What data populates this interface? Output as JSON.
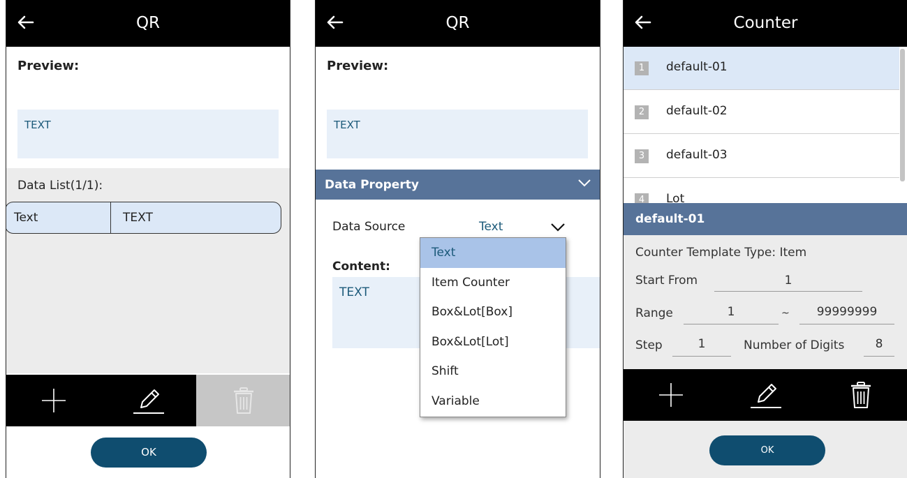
{
  "screen1": {
    "title": "QR",
    "preview_label": "Preview:",
    "preview_text": "TEXT",
    "data_list_title": "Data List(1/1):",
    "row": {
      "type": "Text",
      "value": "TEXT"
    },
    "toolbar": [
      "plus-icon",
      "pencil-icon",
      "trash-icon"
    ],
    "ok_label": "OK"
  },
  "screen2": {
    "title": "QR",
    "preview_label": "Preview:",
    "preview_text": "TEXT",
    "section_title": "Data Property",
    "data_source_label": "Data Source",
    "data_source_value": "Text",
    "content_label": "Content:",
    "content_text": "TEXT",
    "dropdown_options": [
      "Text",
      "Item Counter",
      "Box&Lot[Box]",
      "Box&Lot[Lot]",
      "Shift",
      "Variable"
    ],
    "dropdown_selected": "Text"
  },
  "screen3": {
    "title": "Counter",
    "counters": [
      {
        "num": "1",
        "name": "default-01"
      },
      {
        "num": "2",
        "name": "default-02"
      },
      {
        "num": "3",
        "name": "default-03"
      },
      {
        "num": "4",
        "name": "Lot"
      }
    ],
    "selected_index": 0,
    "detail_title": "default-01",
    "template_type": "Counter Template Type: Item",
    "start_from_label": "Start From",
    "start_from_value": "1",
    "range_label": "Range",
    "range_min": "1",
    "range_sep": "~",
    "range_max": "99999999",
    "step_label": "Step",
    "step_value": "1",
    "digits_label": "Number of Digits",
    "digits_value": "8",
    "toolbar": [
      "plus-icon",
      "pencil-icon",
      "trash-icon"
    ],
    "ok_label": "OK"
  },
  "colors": {
    "header": "#000000",
    "accent_blue": "#577399",
    "ok_button": "#0f4d6f",
    "selected_row": "#dce8f7",
    "dropdown_selected": "#a9c3e8"
  }
}
